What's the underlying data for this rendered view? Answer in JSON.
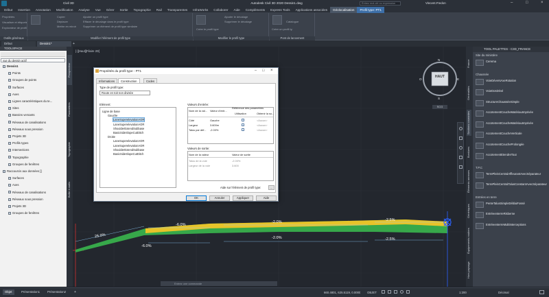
{
  "app": {
    "product": "Civil 3D",
    "title": "Autodesk Civil 3D 2020   Dessin1.dwg",
    "search_placeholder": "Entrez mot-clé ou expression",
    "user": "Vincent.Fredon"
  },
  "ribbon_tabs": [
    "Début",
    "Insertion",
    "Annotation",
    "Modification",
    "Analyse",
    "Vue",
    "Gérer",
    "Sortie",
    "Topographie",
    "Rail",
    "Transparentes",
    "InfraWorks",
    "Collaborer",
    "Aide",
    "Compléments",
    "Express Tools",
    "Applications associées",
    "Géolocalisation",
    "Profil type: PT1"
  ],
  "ribbon_panels": [
    {
      "title": "Outils généraux",
      "buttons": [
        "Propriétés",
        "Visualiser et étiqueter",
        "Explorateur de profil type"
      ]
    },
    {
      "title": "Modifier l'élément de profil type",
      "buttons": [
        "Copier",
        "Déplacer",
        "Mettre en miroir",
        "Ajouter un profil type",
        "Effacer le décalage dans le profil type",
        "Supprimer un élément de profil type similaire"
      ]
    },
    {
      "title": "Modifier le profil type",
      "buttons": [
        "Ajouter le décalage",
        "Supprimer le décalage",
        "Créer le profil type"
      ]
    },
    {
      "title": "Pont de lancement",
      "buttons": [
        "Catalogue",
        "Créer un profil type"
      ]
    }
  ],
  "file_tabs": [
    "Début",
    "Dessin1*"
  ],
  "toolspace": {
    "title": "TOOLSPACE",
    "combo": "vue du dessin actif",
    "tree": [
      {
        "label": "Dessin1",
        "level": 0,
        "bold": true
      },
      {
        "label": "Points",
        "level": 1
      },
      {
        "label": "Groupes de points",
        "level": 1
      },
      {
        "label": "Surfaces",
        "level": 1
      },
      {
        "label": "Axes",
        "level": 1
      },
      {
        "label": "Lignes caractéristiques du te...",
        "level": 1
      },
      {
        "label": "Sites",
        "level": 1
      },
      {
        "label": "Bassins versants",
        "level": 1
      },
      {
        "label": "Réseaux de canalisations",
        "level": 1
      },
      {
        "label": "Réseaux sous pression",
        "level": 1
      },
      {
        "label": "Projets 3D",
        "level": 1
      },
      {
        "label": "Profils types",
        "level": 1
      },
      {
        "label": "Intersections",
        "level": 1
      },
      {
        "label": "Topographie",
        "level": 1
      },
      {
        "label": "Groupes de fenêtres",
        "level": 1
      },
      {
        "label": "Raccourcis aux données []",
        "level": 0
      },
      {
        "label": "Surfaces",
        "level": 1
      },
      {
        "label": "Axes",
        "level": 1
      },
      {
        "label": "Réseaux de canalisations",
        "level": 1
      },
      {
        "label": "Réseaux sous pression",
        "level": 1
      },
      {
        "label": "Projets 3D",
        "level": 1
      },
      {
        "label": "Groupes de fenêtres",
        "level": 1
      }
    ],
    "vtabs": [
      "Prospecteur",
      "Paramètres",
      "Topographie",
      "Boîte à outils"
    ]
  },
  "viewport": {
    "label": "[-][Haut][Filaire 2D]",
    "viewcube_face": "HAUT",
    "compass": {
      "n": "N",
      "s": "S",
      "e": "E",
      "w": "O"
    },
    "wcs": "SCG",
    "slope_labels": [
      "25.0%",
      "-6.0%",
      "-6.0%",
      "-2.0%",
      "-2.0%",
      "-2.5%",
      "-2.5%"
    ]
  },
  "dialog": {
    "title": "Propriétés du profil type - PT1",
    "tabs": [
      "Informations",
      "Construction",
      "Codes"
    ],
    "selected_tab": "Construction",
    "type_label": "Type de profil type:",
    "type_value": "Route en toit non divisée",
    "element_label": "Elément:",
    "tree": [
      {
        "label": "Ligne de base",
        "level": 0
      },
      {
        "label": "Gauche",
        "level": 1
      },
      {
        "label": "LaneSuperelevationAOR",
        "level": 2,
        "selected": true
      },
      {
        "label": "LaneSuperelevationAOR",
        "level": 2
      },
      {
        "label": "ShoulderExtendSubbase",
        "level": 2
      },
      {
        "label": "BasicSideSlopeCutDitch",
        "level": 2
      },
      {
        "label": "Droite",
        "level": 1
      },
      {
        "label": "LaneSuperelevationAOR",
        "level": 2
      },
      {
        "label": "LaneSuperelevationAOR",
        "level": 2
      },
      {
        "label": "ShoulderExtendSubbase",
        "level": 2
      },
      {
        "label": "BasicSideSlopeCutDitch",
        "level": 2
      }
    ],
    "input_label": "Valeurs d'entrée:",
    "input_headers": [
      "Nom de la val...",
      "Valeur d'entr...",
      "Référence des paramètres",
      "Utilisation",
      "Obtenir la so..."
    ],
    "input_rows": [
      {
        "name": "Côté",
        "value": "Gauche",
        "src": "<Aucun>"
      },
      {
        "name": "Largeur",
        "value": "3.600m",
        "src": "<Aucun>"
      },
      {
        "name": "Talus par déf...",
        "value": "-2.00%",
        "src": "<Aucun>"
      }
    ],
    "output_label": "Valeurs de sortie:",
    "output_headers": [
      "Nom de la valeur",
      "Valeur de sortie"
    ],
    "output_rows": [
      {
        "name": "Talus de la voie",
        "value": "-2.00%"
      },
      {
        "name": "Largeur de la voie",
        "value": "3.600"
      }
    ],
    "help_link": "Aide sur l'élément de profil type:",
    "help_btn": "...",
    "buttons": [
      "OK",
      "Annuler",
      "Appliquer",
      "Aide"
    ]
  },
  "palette": {
    "title": "TOOL PALETTES - C3D_FRANCE",
    "sections": [
      {
        "title": "Site du ministère",
        "items": [
          "Cerema"
        ]
      },
      {
        "title": "Chaussée",
        "items": [
          "VoieDéversAxeRotation",
          "VoieDosDévé",
          "StructureChausséeSimple",
          "AccotementCoucheMatériauImprivée",
          "AccotementCoucheMatériauImprivée",
          "AccotementCoucheVerticale",
          "AccotementCoucheProlongée",
          "AccotementEtendreTout"
        ]
      },
      {
        "title": "T.P.C",
        "items": [
          "TerrePleinCentralAffleurantAvecSéparateur",
          "TerrePleinCentralTalusConstantAvecSéparateur"
        ]
      },
      {
        "title": "Entrées en terre",
        "items": [
          "PenteTalusSimpleDéblaiFossé",
          "EntréeenterreRisberne",
          "EntréeenterreMultiInterceptions"
        ]
      }
    ],
    "vtabs": [
      "France",
      "Généralités",
      "Sections courantes",
      "Bordures",
      "Éléments annexes",
      "Génériques",
      "Équipements routiers",
      "Hors paysage"
    ]
  },
  "command_line": {
    "placeholder": "Entrez une commande"
  },
  "status": {
    "layout_tabs": [
      "Objet",
      "Présentation1",
      "Présentation2"
    ],
    "coords": "660.4801, 625.5119, 0.0000",
    "model": "OBJET",
    "scale": "1:200",
    "units": "Décimal"
  },
  "colors": {
    "accent": "#3d6fa8",
    "road_yellow": "#e7c32a",
    "road_green": "#37a84a",
    "marker_blue": "#2d63ff",
    "axis_red": "#d03030"
  }
}
